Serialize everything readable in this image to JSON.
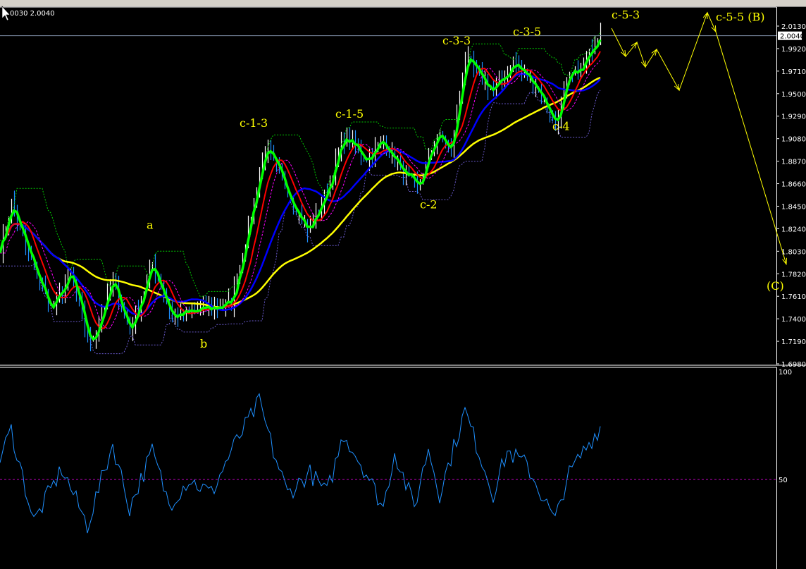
{
  "header": {
    "info_text": "0030 2.0040"
  },
  "colors": {
    "background": "#000000",
    "bars_up": "#ffffff",
    "bars_down": "#1e90ff",
    "fast_ma": "#00ff00",
    "mid_ma": "#ff0000",
    "slow_ma": "#0000ff",
    "long_ma": "#ffff00",
    "envelope_upper": "#00cc00",
    "envelope_lower": "#6a5acd",
    "oscillator": "#1e90ff",
    "oscillator_level": "#c000c0",
    "annotations": "#ffff00"
  },
  "chart_data": [
    {
      "type": "line",
      "panel": "price",
      "ylim": [
        1.698,
        2.013
      ],
      "yticks": [
        "2.0130",
        "1.9920",
        "1.9710",
        "1.9500",
        "1.9290",
        "1.9080",
        "1.8870",
        "1.8660",
        "1.8450",
        "1.8240",
        "1.8030",
        "1.7820",
        "1.7610",
        "1.7400",
        "1.7190",
        "1.6980"
      ],
      "current_price": "2.0040",
      "price_path": {
        "x": [
          0,
          4,
          10,
          18,
          25,
          32,
          40,
          46,
          54,
          61,
          72,
          82,
          86,
          94,
          102,
          109,
          115,
          122,
          130,
          136,
          142,
          148,
          155,
          160,
          165,
          175,
          182,
          190,
          197,
          202,
          207,
          213
        ],
        "y": [
          1.8073,
          1.8468,
          1.8008,
          1.7482,
          1.7811,
          1.7154,
          1.7745,
          1.7285,
          1.7909,
          1.7417,
          1.7482,
          1.7548,
          1.8008,
          1.8993,
          1.8599,
          1.8205,
          1.8533,
          1.9092,
          1.8895,
          1.9059,
          1.8796,
          1.8599,
          1.9125,
          1.8961,
          1.9815,
          1.9519,
          1.9782,
          1.9585,
          1.9223,
          1.965,
          1.9749,
          2.011
        ]
      },
      "forecast_path": {
        "x": [
          217,
          222,
          226,
          229,
          233,
          241,
          251,
          254,
          279
        ],
        "y": [
          2.011,
          1.9847,
          1.9979,
          1.9749,
          1.9913,
          1.9532,
          2.0255,
          2.0077,
          1.7909
        ]
      },
      "annotations": [
        {
          "text": "a",
          "x": 52,
          "y": 1.824
        },
        {
          "text": "b",
          "x": 71,
          "y": 1.713
        },
        {
          "text": "c-1-3",
          "x": 85,
          "y": 1.919
        },
        {
          "text": "c-1-5",
          "x": 119,
          "y": 1.9275
        },
        {
          "text": "c-2",
          "x": 149,
          "y": 1.843
        },
        {
          "text": "c-3-3",
          "x": 157,
          "y": 1.996
        },
        {
          "text": "c-3-5",
          "x": 182,
          "y": 2.004
        },
        {
          "text": "c-4",
          "x": 196,
          "y": 1.916
        },
        {
          "text": "c-5-3",
          "x": 217,
          "y": 2.02
        },
        {
          "text": "c-5-5 (B)",
          "x": 254,
          "y": 2.018
        },
        {
          "text": "(C)",
          "x": 272,
          "y": 1.767
        }
      ]
    },
    {
      "type": "line",
      "panel": "oscillator",
      "ylim": [
        0,
        100
      ],
      "yticks": [
        "100",
        "50"
      ],
      "level": 50,
      "x": [
        0,
        4,
        12,
        22,
        31,
        40,
        46,
        54,
        60,
        67,
        75,
        82,
        92,
        97,
        102,
        110,
        116,
        122,
        130,
        136,
        140,
        147,
        152,
        156,
        165,
        175,
        180,
        187,
        192,
        197,
        201,
        207,
        213
      ],
      "y": [
        59.8,
        72.9,
        30.4,
        54.9,
        28.7,
        66.3,
        36.9,
        63,
        38.6,
        50,
        43.5,
        63,
        85.9,
        63,
        43.5,
        53,
        43.5,
        71.2,
        53,
        36.9,
        63,
        36.9,
        64.7,
        43.5,
        81.7,
        43.5,
        63,
        56.5,
        43.5,
        30.4,
        50,
        63,
        74.5
      ]
    }
  ]
}
